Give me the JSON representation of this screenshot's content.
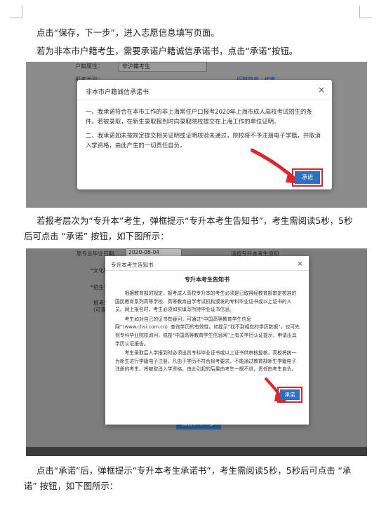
{
  "paragraphs": {
    "p1": "点击“保存，下一步”，进入志愿信息填写页面。",
    "p2": "若为非本市户籍考生，需要承诺户籍诚信承诺书，点击“承诺”按钮。",
    "p3": "若报考层次为“专升本”考生，弹框提示“专升本考生告知书”，考生需阅读5秒，5秒后可点击 “承诺” 按钮，如下图所示：",
    "p4": "点击“承诺”后，弹框提示“专升本考生承诺书”，考生需阅读5秒，5秒后可点击 “承诺” 按钮，如下图所示："
  },
  "screenshot1": {
    "bg_label": "户籍属性：",
    "bg_select": "非沪籍考生",
    "bg_label2": "报考类别：",
    "bg_links": "招聘简章 · 搜索",
    "dialog_title": "非本市户籍诚信承诺书",
    "close": "×",
    "body": [
      "一、我承诺符合在本市工作的非上海常住户口报考2020年上海市成人高校考试招生的条件。若被录取，在新生录取报到时向录取院校提交在上海工作的单位证明。",
      "二、我承诺如未按规定提交相关证明或证明核验未通过，院校将不予注册电子学籍，并取消入学资格，由此产生的一切责任自负。"
    ],
    "button": "承诺"
  },
  "screenshot2": {
    "bg_date_label": "原专业毕业日期:",
    "bg_date_value": "2020-08-04",
    "bg_hint": "请按专升本考生须知",
    "bg_labels": [
      "*文化程度",
      "*招生专业",
      "报考须知",
      "(可查阅)"
    ],
    "dialog_title": "专升本考生告知书",
    "close": "×",
    "heading": "专升本考生告知书",
    "body": [
      "根据教育部的规定，报考成人高校专升本的考生必须是已取得经教育部审定核准的国民教育系列高等学校、高等教育自学考试机构颁发的专科毕业证书或以上证书的人员。网上报名时，考生必须如实填写所持毕业证书信息。",
      "考生如对自己的证书有疑问，可通过“中国高等教育学生信息网”（www.chsi.com.cn）查询学历的有效性。如提示“找不到相应的学历数据”，也可先到专科毕业院校询问，或按“中国高等教育学生信息网”上有关学历认证提示，申请出具学历认证报告。",
      "考生录取后入学报到时必须出具专科毕业证书或以上证书供审核复核，高校将统一为新生进行学籍电子注册。凡由于学历不符合报考要求，不能通过教育部新生学籍电子注册的考生，将被取消入学资格，由此引起的后果由考生一概不退，责任由考生自负。"
    ],
    "button": "承诺",
    "save_button": "保存，下一步"
  },
  "colors": {
    "primary_button": "#2f6fbe",
    "highlight_box": "#e0242c",
    "arrow": "#e0242c"
  }
}
